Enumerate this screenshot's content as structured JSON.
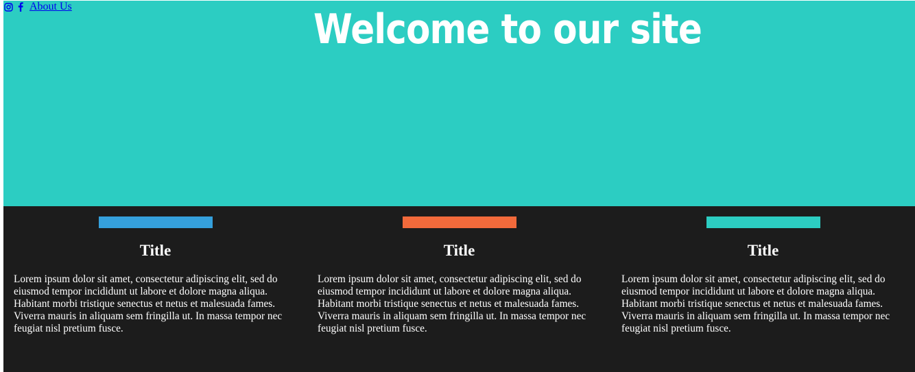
{
  "nav": {
    "icons": [
      "instagram-icon",
      "facebook-icon"
    ],
    "about_label": "About Us",
    "link_color": "#0000ee"
  },
  "hero": {
    "title": "Welcome to our site",
    "background": "#2ccdc2"
  },
  "features": {
    "background": "#1c1c1c",
    "items": [
      {
        "accent": "#35a0dc",
        "title": "Title",
        "body": "Lorem ipsum dolor sit amet, consectetur adipiscing elit, sed do eiusmod tempor incididunt ut labore et dolore magna aliqua. Habitant morbi tristique senectus et netus et malesuada fames. Viverra mauris in aliquam sem fringilla ut. In massa tempor nec feugiat nisl pretium fusce."
      },
      {
        "accent": "#f26a3b",
        "title": "Title",
        "body": "Lorem ipsum dolor sit amet, consectetur adipiscing elit, sed do eiusmod tempor incididunt ut labore et dolore magna aliqua. Habitant morbi tristique senectus et netus et malesuada fames. Viverra mauris in aliquam sem fringilla ut. In massa tempor nec feugiat nisl pretium fusce."
      },
      {
        "accent": "#2ccdc2",
        "title": "Title",
        "body": "Lorem ipsum dolor sit amet, consectetur adipiscing elit, sed do eiusmod tempor incididunt ut labore et dolore magna aliqua. Habitant morbi tristique senectus et netus et malesuada fames. Viverra mauris in aliquam sem fringilla ut. In massa tempor nec feugiat nisl pretium fusce."
      }
    ]
  }
}
